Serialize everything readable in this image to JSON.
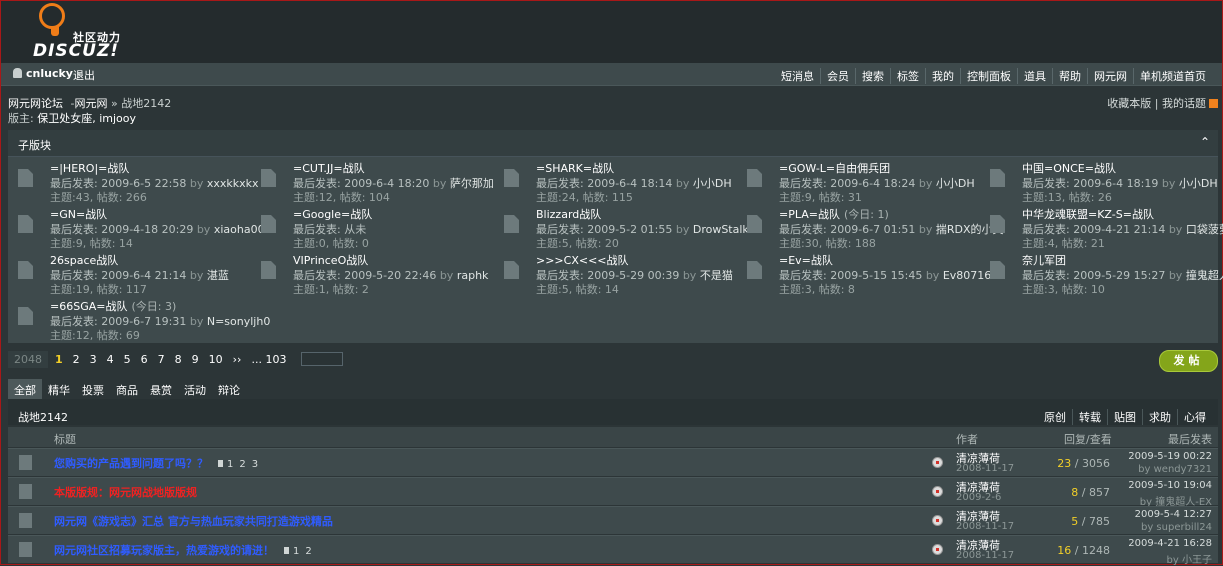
{
  "logo": {
    "cn": "社区动力",
    "en": "DISCUZ!"
  },
  "topnav": {
    "user": "cnlucky",
    "logout": "退出",
    "links": [
      "短消息",
      "会员",
      "搜索",
      "标签",
      "我的",
      "控制面板",
      "道具",
      "帮助",
      "网元网",
      "单机频道首页"
    ]
  },
  "breadcrumb": {
    "home": "网元网论坛",
    "sep": "-",
    "site": "网元网",
    "current": "» 战地2142"
  },
  "moderators": {
    "label": "版主:",
    "names": "保卫处女座, imjooy"
  },
  "favorites": {
    "fav": "收藏本版",
    "topics": "我的话题"
  },
  "subforums": {
    "title": "子版块",
    "items": [
      {
        "name": "=|HERO|=战队",
        "today": "",
        "last_label": "最后发表:",
        "last_time": "2009-6-5 22:58",
        "by": "by",
        "user": "xxxkkxkx",
        "stats": "主题:43, 帖数: 266"
      },
      {
        "name": "=CUT.JJ=战队",
        "today": "",
        "last_label": "最后发表:",
        "last_time": "2009-6-4 18:20",
        "by": "by",
        "user": "萨尔那加",
        "stats": "主题:12, 帖数: 104"
      },
      {
        "name": "=SHARK=战队",
        "today": "",
        "last_label": "最后发表:",
        "last_time": "2009-6-4 18:14",
        "by": "by",
        "user": "小小DH",
        "stats": "主题:24, 帖数: 115"
      },
      {
        "name": "=GOW-L=自由佣兵团",
        "today": "",
        "last_label": "最后发表:",
        "last_time": "2009-6-4 18:24",
        "by": "by",
        "user": "小小DH",
        "stats": "主题:9, 帖数: 31"
      },
      {
        "name": "中国=ONCE=战队",
        "today": "",
        "last_label": "最后发表:",
        "last_time": "2009-6-4 18:19",
        "by": "by",
        "user": "小小DH",
        "stats": "主题:13, 帖数: 26"
      },
      {
        "name": "=GN=战队",
        "today": "",
        "last_label": "最后发表:",
        "last_time": "2009-4-18 20:29",
        "by": "by",
        "user": "xiaoha001",
        "stats": "主题:9, 帖数: 14"
      },
      {
        "name": "=Google=战队",
        "today": "",
        "last_label": "最后发表:",
        "last_time": "从未",
        "by": "",
        "user": "",
        "stats": "主题:0, 帖数: 0"
      },
      {
        "name": "Blizzard战队",
        "today": "",
        "last_label": "最后发表:",
        "last_time": "2009-5-2 01:55",
        "by": "by",
        "user": "DrowStalker",
        "stats": "主题:5, 帖数: 20"
      },
      {
        "name": "=PLA=战队",
        "today": "(今日: 1)",
        "last_label": "最后发表:",
        "last_time": "2009-6-7 01:51",
        "by": "by",
        "user": "揣RDX的小文",
        "stats": "主题:30, 帖数: 188"
      },
      {
        "name": "中华龙魂联盟=KZ-S=战队",
        "today": "",
        "last_label": "最后发表:",
        "last_time": "2009-4-21 21:14",
        "by": "by",
        "user": "口袋菠萝",
        "stats": "主题:4, 帖数: 21"
      },
      {
        "name": "26space战队",
        "today": "",
        "last_label": "最后发表:",
        "last_time": "2009-6-4 21:14",
        "by": "by",
        "user": "湛蓝",
        "stats": "主题:19, 帖数: 117"
      },
      {
        "name": "VIPrinceO战队",
        "today": "",
        "last_label": "最后发表:",
        "last_time": "2009-5-20 22:46",
        "by": "by",
        "user": "raphk",
        "stats": "主题:1, 帖数: 2"
      },
      {
        "name": ">>>CX<<<战队",
        "today": "",
        "last_label": "最后发表:",
        "last_time": "2009-5-29 00:39",
        "by": "by",
        "user": "不是猫",
        "stats": "主题:5, 帖数: 14"
      },
      {
        "name": "=Ev=战队",
        "today": "",
        "last_label": "最后发表:",
        "last_time": "2009-5-15 15:45",
        "by": "by",
        "user": "Ev80716",
        "stats": "主题:3, 帖数: 8"
      },
      {
        "name": "奈儿军团",
        "today": "",
        "last_label": "最后发表:",
        "last_time": "2009-5-29 15:27",
        "by": "by",
        "user": "撞鬼超人-EX",
        "stats": "主题:3, 帖数: 10"
      },
      {
        "name": "=66SGA=战队",
        "today": "(今日: 3)",
        "last_label": "最后发表:",
        "last_time": "2009-6-7 19:31",
        "by": "by",
        "user": "N=sonyljh0",
        "stats": "主题:12, 帖数: 69"
      }
    ]
  },
  "pager": {
    "total": "2048",
    "pages": [
      "1",
      "2",
      "3",
      "4",
      "5",
      "6",
      "7",
      "8",
      "9",
      "10",
      "››",
      "... 103"
    ],
    "current": "1"
  },
  "post_button": "发帖",
  "tabs": [
    "全部",
    "精华",
    "投票",
    "商品",
    "悬赏",
    "活动",
    "辩论"
  ],
  "list": {
    "forum_name": "战地2142",
    "filters": [
      "原创",
      "转载",
      "贴图",
      "求助",
      "心得"
    ],
    "columns": {
      "title": "标题",
      "author": "作者",
      "replies": "回复/查看",
      "last": "最后发表"
    },
    "threads": [
      {
        "title": "您购买的产品遇到问题了吗？？",
        "color": "#2f5cff",
        "pages": [
          "1",
          "2",
          "3"
        ],
        "author": "清凉薄荷",
        "date": "2008-11-17",
        "replies": "23",
        "views": "/ 3056",
        "last_time": "2009-5-19 00:22",
        "last_by": "by wendy7321"
      },
      {
        "title": "本版版规：网元网战地版版规",
        "color": "#ee2222",
        "pages": [],
        "author": "清凉薄荷",
        "date": "2009-2-6",
        "replies": "8",
        "views": "/ 857",
        "last_time": "2009-5-10 19:04",
        "last_by": "by 撞鬼超人-EX"
      },
      {
        "title": "网元网《游戏志》汇总 官方与热血玩家共同打造游戏精品",
        "color": "#2f5cff",
        "pages": [],
        "author": "清凉薄荷",
        "date": "2008-11-17",
        "replies": "5",
        "views": "/ 785",
        "last_time": "2009-5-4 12:27",
        "last_by": "by superbill24"
      },
      {
        "title": "网元网社区招募玩家版主，热爱游戏的请进！",
        "color": "#2f5cff",
        "pages": [
          "1",
          "2"
        ],
        "author": "清凉薄荷",
        "date": "2008-11-17",
        "replies": "16",
        "views": "/ 1248",
        "last_time": "2009-4-21 16:28",
        "last_by": "by 小王子"
      }
    ]
  }
}
